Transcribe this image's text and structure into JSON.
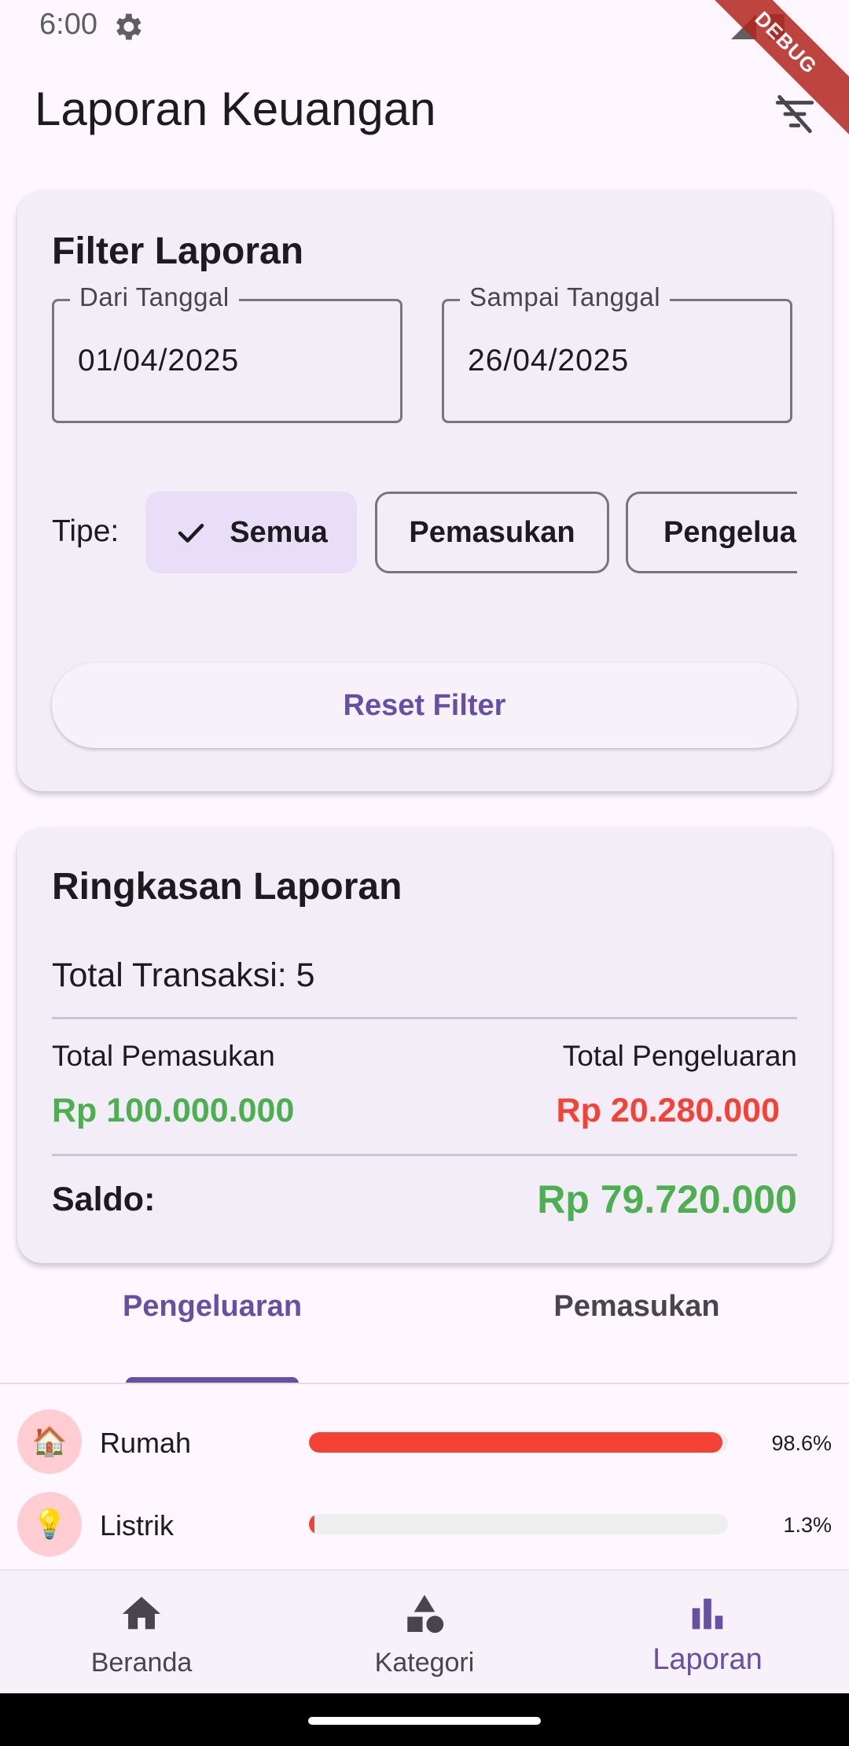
{
  "status_bar": {
    "time": "6:00",
    "debug_label": "DEBUG"
  },
  "app_bar": {
    "title": "Laporan Keuangan",
    "action_icon": "filter-off-icon"
  },
  "filter_card": {
    "title": "Filter Laporan",
    "from_label": "Dari Tanggal",
    "from_value": "01/04/2025",
    "to_label": "Sampai Tanggal",
    "to_value": "26/04/2025",
    "type_label": "Tipe:",
    "chips": [
      {
        "label": "Semua",
        "selected": true
      },
      {
        "label": "Pemasukan",
        "selected": false
      },
      {
        "label": "Pengeluaran",
        "selected": false
      }
    ],
    "reset_label": "Reset Filter"
  },
  "summary_card": {
    "title": "Ringkasan Laporan",
    "total_transactions": "Total Transaksi: 5",
    "income_label": "Total Pemasukan",
    "income_value": "Rp 100.000.000",
    "expense_label": "Total Pengeluaran",
    "expense_value": "Rp 20.280.000",
    "balance_label": "Saldo:",
    "balance_value": "Rp 79.720.000"
  },
  "tabs": [
    {
      "label": "Pengeluaran",
      "active": true
    },
    {
      "label": "Pemasukan",
      "active": false
    }
  ],
  "categories": [
    {
      "icon": "🏠",
      "name": "Rumah",
      "percent": 98.6,
      "percent_label": "98.6%"
    },
    {
      "icon": "💡",
      "name": "Listrik",
      "percent": 1.3,
      "percent_label": "1.3%"
    }
  ],
  "bottom_nav": [
    {
      "label": "Beranda",
      "icon": "home-icon",
      "active": false
    },
    {
      "label": "Kategori",
      "icon": "category-icon",
      "active": false
    },
    {
      "label": "Laporan",
      "icon": "bar-chart-icon",
      "active": true
    }
  ],
  "colors": {
    "primary": "#6750A4",
    "income": "#4CAF50",
    "expense": "#F44336",
    "background": "#FEF7FF",
    "card": "#F3EDF7"
  }
}
